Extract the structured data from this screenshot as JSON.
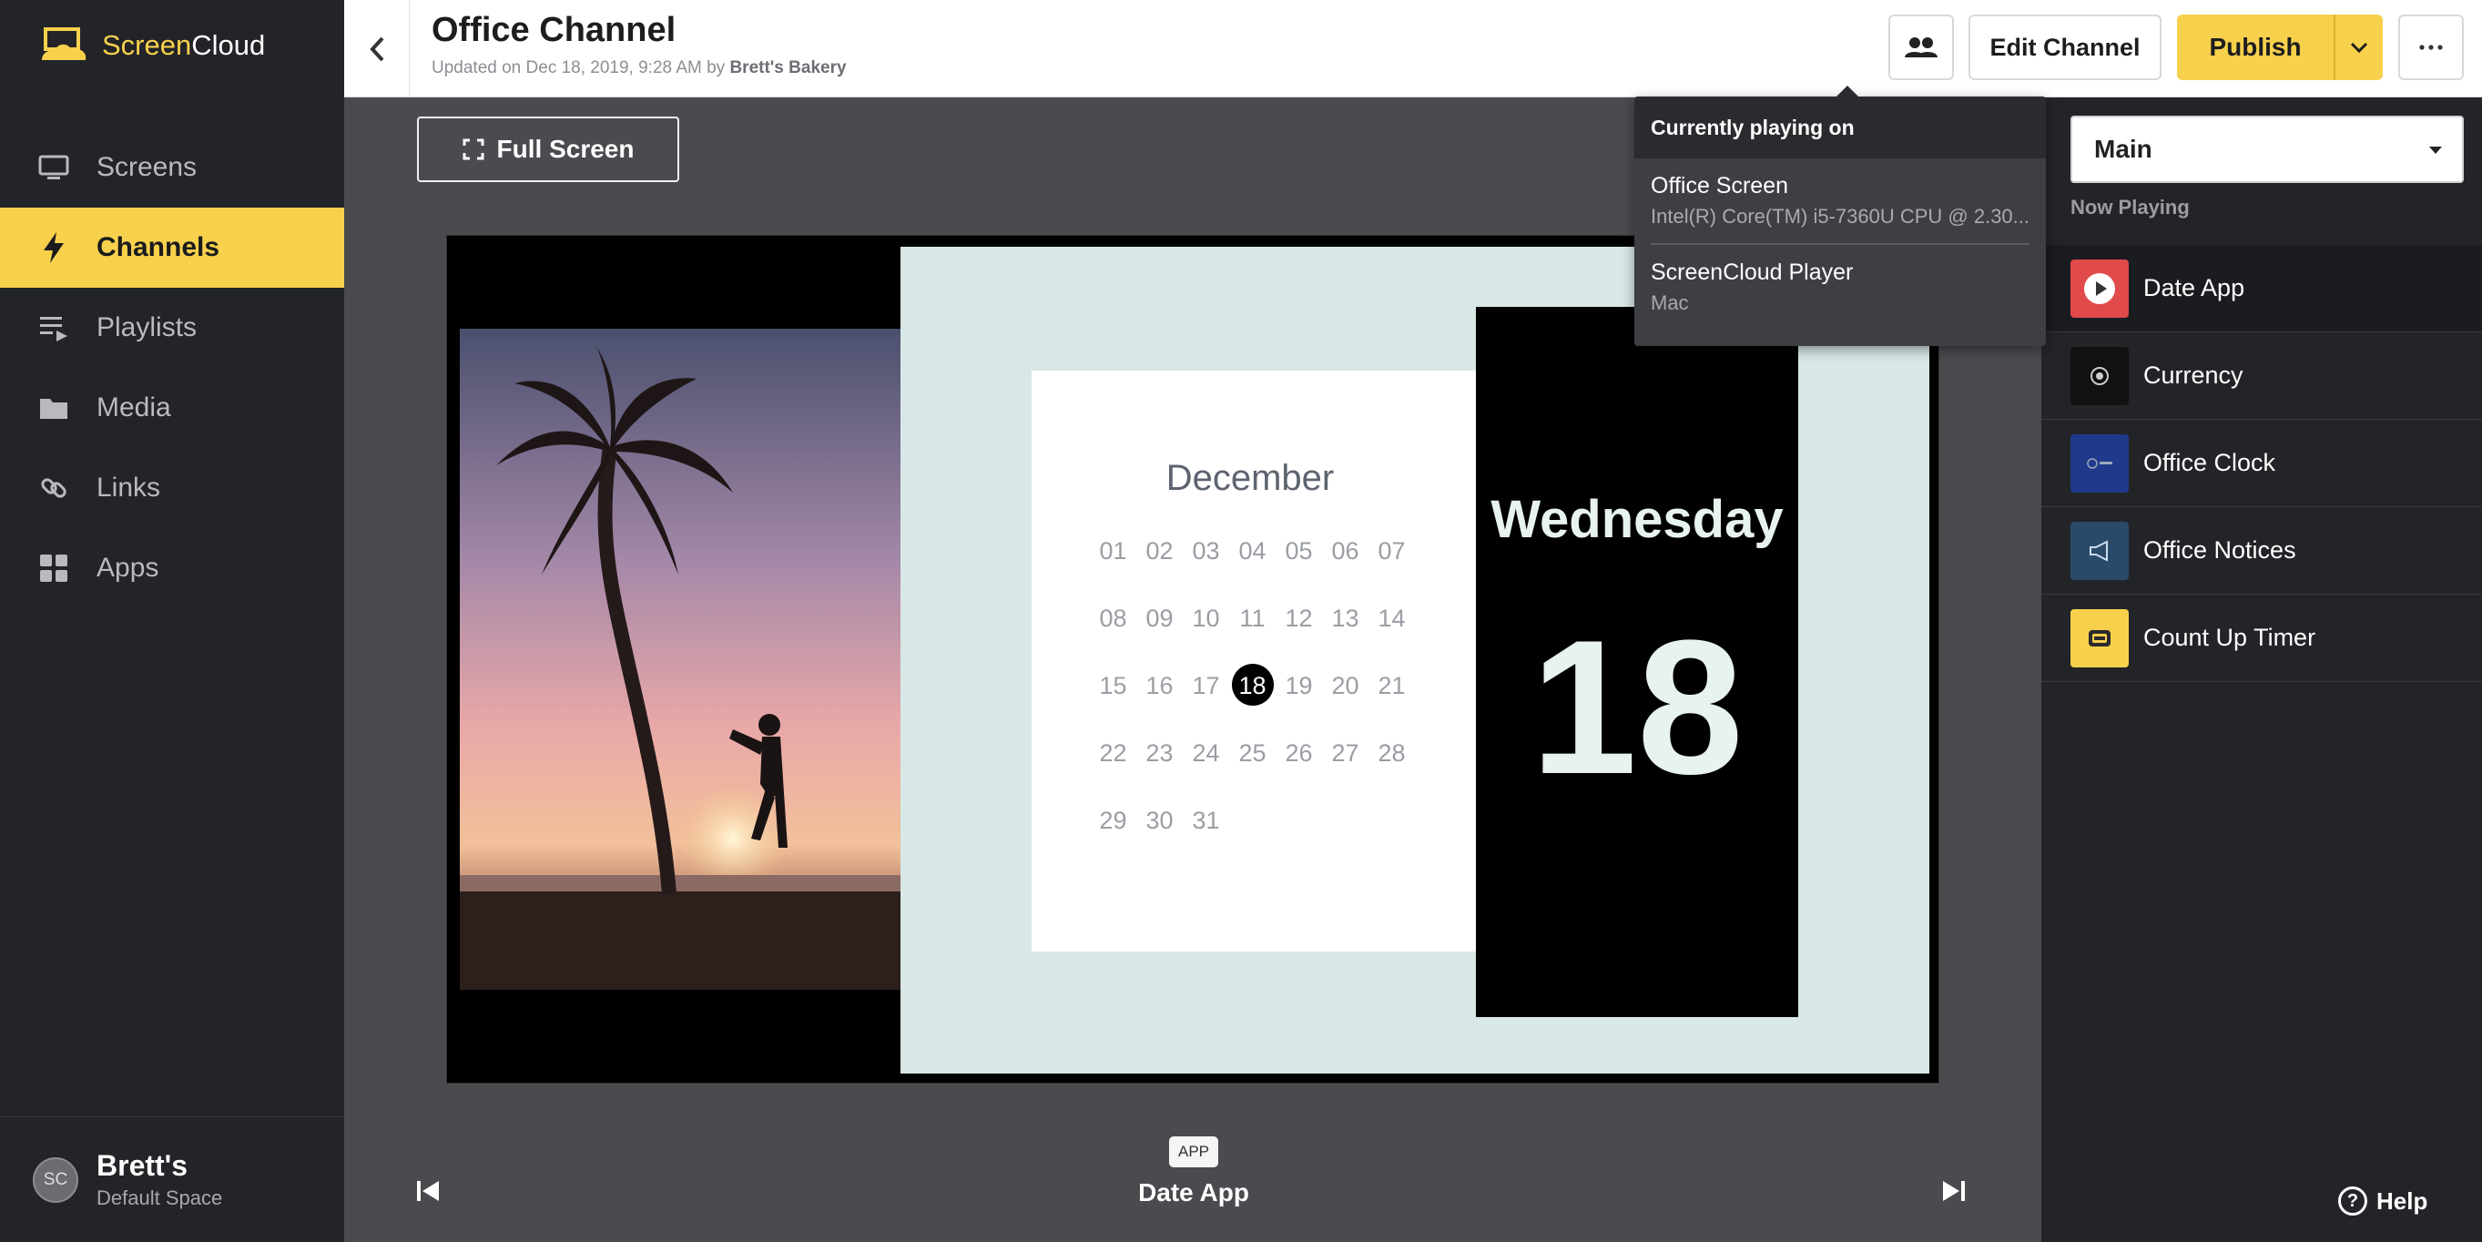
{
  "app": {
    "name_part1": "Screen",
    "name_part2": "Cloud"
  },
  "sidebar": {
    "items": [
      {
        "label": "Screens",
        "icon": "monitor-icon"
      },
      {
        "label": "Channels",
        "icon": "lightning-icon",
        "active": true
      },
      {
        "label": "Playlists",
        "icon": "playlist-icon"
      },
      {
        "label": "Media",
        "icon": "folder-icon"
      },
      {
        "label": "Links",
        "icon": "link-icon"
      },
      {
        "label": "Apps",
        "icon": "grid-icon"
      }
    ],
    "footer": {
      "avatar_initials": "SC",
      "space_name": "Brett's",
      "space_sub": "Default Space"
    }
  },
  "header": {
    "title": "Office Channel",
    "updated_prefix": "Updated on Dec 18, 2019, 9:28 AM by ",
    "updated_by": "Brett's Bakery",
    "edit_label": "Edit Channel",
    "publish_label": "Publish"
  },
  "preview": {
    "fullscreen_label": "Full Screen",
    "month": "December",
    "days": [
      "01",
      "02",
      "03",
      "04",
      "05",
      "06",
      "07",
      "08",
      "09",
      "10",
      "11",
      "12",
      "13",
      "14",
      "15",
      "16",
      "17",
      "18",
      "19",
      "20",
      "21",
      "22",
      "23",
      "24",
      "25",
      "26",
      "27",
      "28",
      "29",
      "30",
      "31"
    ],
    "today": "18",
    "weekday": "Wednesday",
    "day_number": "18",
    "badge": "APP",
    "now_title": "Date App"
  },
  "popover": {
    "heading": "Currently playing on",
    "screens": [
      {
        "name": "Office Screen",
        "desc": "Intel(R) Core(TM) i5-7360U CPU @ 2.30..."
      },
      {
        "name": "ScreenCloud Player",
        "desc": "Mac"
      }
    ]
  },
  "right_panel": {
    "zone": "Main",
    "now_playing_label": "Now Playing",
    "items": [
      {
        "label": "Date App",
        "thumb_color": "#e04a4a"
      },
      {
        "label": "Currency",
        "thumb_color": "#111111"
      },
      {
        "label": "Office Clock",
        "thumb_color": "#1f3a8a"
      },
      {
        "label": "Office Notices",
        "thumb_color": "#2a4a6a"
      },
      {
        "label": "Count Up Timer",
        "thumb_color": "#f8d14c"
      }
    ],
    "help_label": "Help"
  },
  "colors": {
    "accent": "#f8d14c",
    "sidebar_bg": "#232428",
    "canvas_bg": "#4a4a4f"
  }
}
